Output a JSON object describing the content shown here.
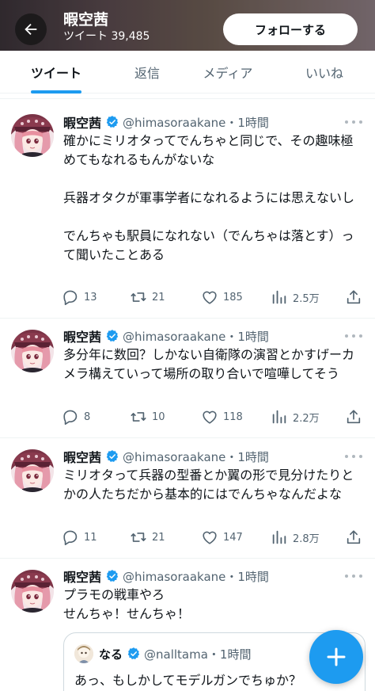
{
  "header": {
    "name": "暇空茜",
    "tweet_count": "ツイート 39,485",
    "follow_label": "フォローする"
  },
  "tabs": [
    {
      "label": "ツイート",
      "active": true
    },
    {
      "label": "返信",
      "active": false
    },
    {
      "label": "メディア",
      "active": false
    },
    {
      "label": "いいね",
      "active": false
    }
  ],
  "tweets": [
    {
      "name": "暇空茜",
      "handle_time": "@himasoraakane・1時間",
      "body": "確かにミリオタってでんちゃと同じで、その趣味極めてもなれるもんがないな\n\n兵器オタクが軍事学者になれるようには思えないし\n\nでんちゃも駅員になれない（でんちゃは落とす）って聞いたことある",
      "replies": "13",
      "retweets": "21",
      "likes": "185",
      "views": "2.5万"
    },
    {
      "name": "暇空茜",
      "handle_time": "@himasoraakane・1時間",
      "body": "多分年に数回？しかない自衛隊の演習とかすげーカメラ構えていって場所の取り合いで喧嘩してそう",
      "replies": "8",
      "retweets": "10",
      "likes": "118",
      "views": "2.2万"
    },
    {
      "name": "暇空茜",
      "handle_time": "@himasoraakane・1時間",
      "body": "ミリオタって兵器の型番とか翼の形で見分けたりとかの人たちだから基本的にはでんちゃなんだよな",
      "replies": "11",
      "retweets": "21",
      "likes": "147",
      "views": "2.8万"
    },
    {
      "name": "暇空茜",
      "handle_time": "@himasoraakane・1時間",
      "body": "プラモの戦車やろ\nせんちゃ！せんちゃ！",
      "quote": {
        "name": "なる",
        "handle_time": "@nalltama・1時間",
        "body": "あっ、もしかしてモデルガンでちゅか？"
      }
    }
  ],
  "colors": {
    "accent": "#1d9bf0",
    "secondary_text": "#536471",
    "primary_text": "#0f1419"
  },
  "icons": {
    "back": "arrow-left-icon",
    "verified": "verified-badge-icon",
    "reply": "reply-icon",
    "retweet": "retweet-icon",
    "like": "heart-icon",
    "views": "views-chart-icon",
    "share": "share-icon",
    "compose": "plus-icon"
  }
}
